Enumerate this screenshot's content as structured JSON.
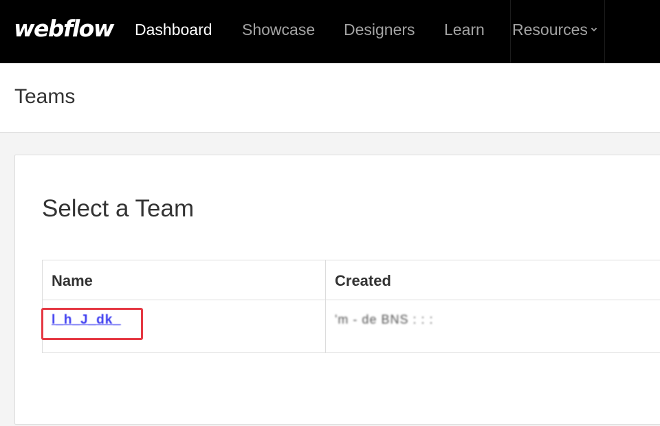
{
  "nav": {
    "logo": "webflow",
    "items": [
      {
        "label": "Dashboard",
        "active": true
      },
      {
        "label": "Showcase",
        "active": false
      },
      {
        "label": "Designers",
        "active": false
      },
      {
        "label": "Learn",
        "active": false
      },
      {
        "label": "Resources",
        "active": false,
        "icon": "chevron-down-icon"
      }
    ]
  },
  "header": {
    "title": "Teams"
  },
  "main": {
    "card_title": "Select a Team",
    "table": {
      "columns": [
        "Name",
        "Created"
      ],
      "rows": [
        {
          "name": "l_h_J_dk_",
          "created": "'m - de BNS : : :"
        }
      ]
    }
  },
  "colors": {
    "nav_bg": "#000000",
    "link": "#3b3bf0",
    "highlight": "#e53843"
  }
}
